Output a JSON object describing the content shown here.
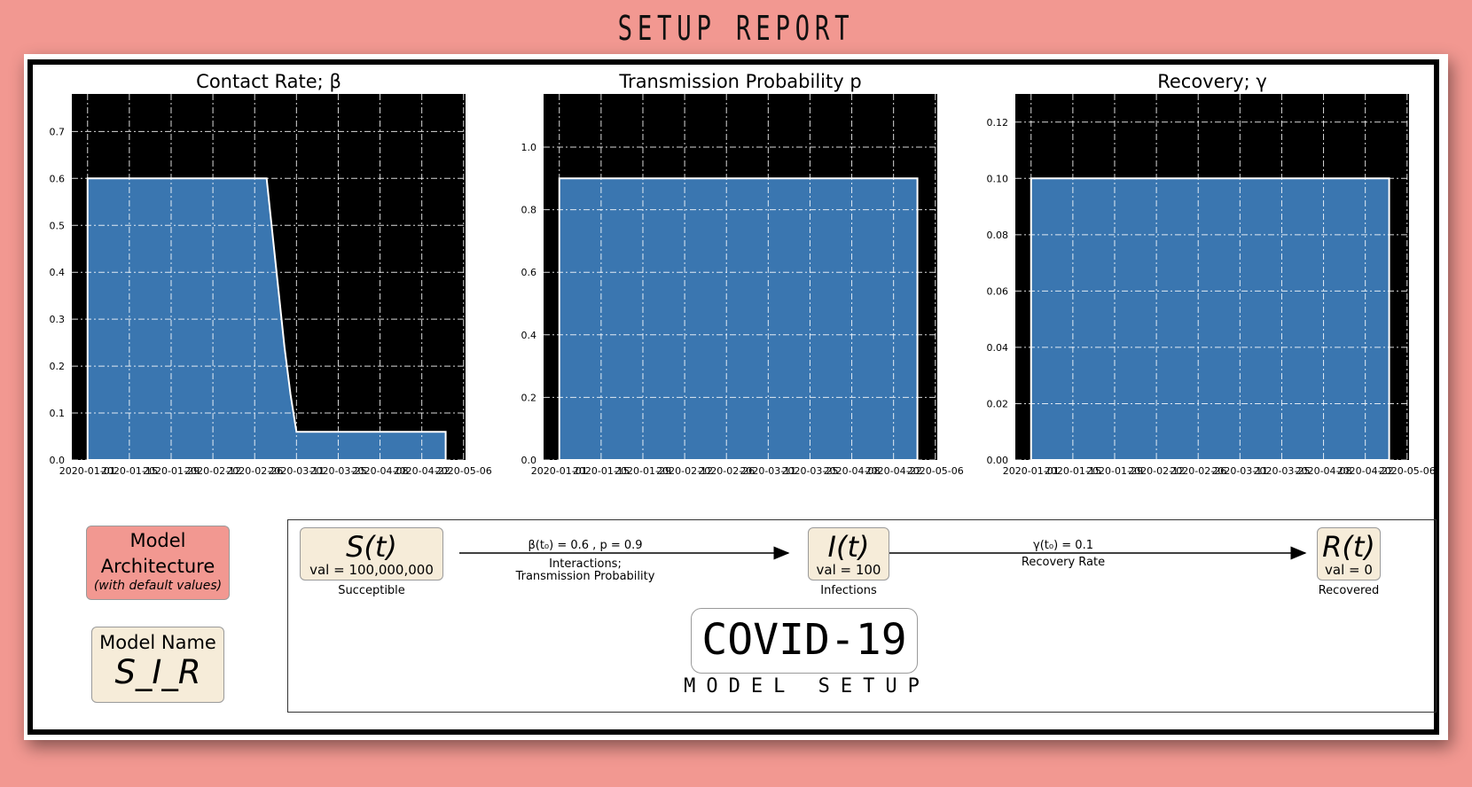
{
  "page_title": "SETUP REPORT",
  "colors": {
    "background": "#f29891",
    "plot_bg": "#000000",
    "fill": "#3a76b0",
    "node_bg": "#f6ecd9",
    "arch_bg": "#f29891"
  },
  "chart_data": [
    {
      "type": "area",
      "title": "Contact Rate; β",
      "x": [
        "2020-01-01",
        "2020-03-01",
        "2020-03-03",
        "2020-03-05",
        "2020-03-07",
        "2020-03-09",
        "2020-03-11",
        "2020-03-15",
        "2020-04-30"
      ],
      "values": [
        0.6,
        0.6,
        0.48,
        0.36,
        0.24,
        0.14,
        0.06,
        0.06,
        0.06
      ],
      "xlim": [
        "2020-01-01",
        "2020-05-06"
      ],
      "ylim": [
        0,
        0.78
      ],
      "xticks": [
        "2020-01-01",
        "2020-01-15",
        "2020-01-29",
        "2020-02-12",
        "2020-02-26",
        "2020-03-11",
        "2020-03-25",
        "2020-04-08",
        "2020-04-22",
        "2020-05-06"
      ],
      "yticks": [
        "0.0",
        "0.1",
        "0.2",
        "0.3",
        "0.4",
        "0.5",
        "0.6",
        "0.7"
      ],
      "grid": true
    },
    {
      "type": "area",
      "title": "Transmission Probability p",
      "x": [
        "2020-01-01",
        "2020-04-30"
      ],
      "values": [
        0.9,
        0.9
      ],
      "xlim": [
        "2020-01-01",
        "2020-05-06"
      ],
      "ylim": [
        0,
        1.17
      ],
      "xticks": [
        "2020-01-01",
        "2020-01-15",
        "2020-01-29",
        "2020-02-12",
        "2020-02-26",
        "2020-03-11",
        "2020-03-25",
        "2020-04-08",
        "2020-04-22",
        "2020-05-06"
      ],
      "yticks": [
        "0.0",
        "0.2",
        "0.4",
        "0.6",
        "0.8",
        "1.0"
      ],
      "grid": true
    },
    {
      "type": "area",
      "title": "Recovery; γ",
      "x": [
        "2020-01-01",
        "2020-04-30"
      ],
      "values": [
        0.1,
        0.1
      ],
      "xlim": [
        "2020-01-01",
        "2020-05-06"
      ],
      "ylim": [
        0,
        0.13
      ],
      "xticks": [
        "2020-01-01",
        "2020-01-15",
        "2020-01-29",
        "2020-02-12",
        "2020-02-26",
        "2020-03-11",
        "2020-03-25",
        "2020-04-08",
        "2020-04-22",
        "2020-05-06"
      ],
      "yticks": [
        "0.00",
        "0.02",
        "0.04",
        "0.06",
        "0.08",
        "0.10",
        "0.12"
      ],
      "grid": true
    }
  ],
  "architecture": {
    "line1": "Model",
    "line2": "Architecture",
    "line3": "(with default values)"
  },
  "model_name": {
    "label": "Model Name",
    "value": "S_I_R"
  },
  "nodes": [
    {
      "symbol": "S(t)",
      "value": "val = 100,000,000",
      "caption": "Succeptible"
    },
    {
      "symbol": "I(t)",
      "value": "val = 100",
      "caption": "Infections"
    },
    {
      "symbol": "R(t)",
      "value": "val = 0",
      "caption": "Recovered"
    }
  ],
  "transitions": [
    {
      "params": "β(t₀) = 0.6 ,  p = 0.9",
      "line1": "Interactions;",
      "line2": "Transmission Probability"
    },
    {
      "params": "γ(t₀) = 0.1",
      "line1": "Recovery Rate"
    }
  ],
  "disease": "COVID-19",
  "subtitle": "MODEL SETUP"
}
